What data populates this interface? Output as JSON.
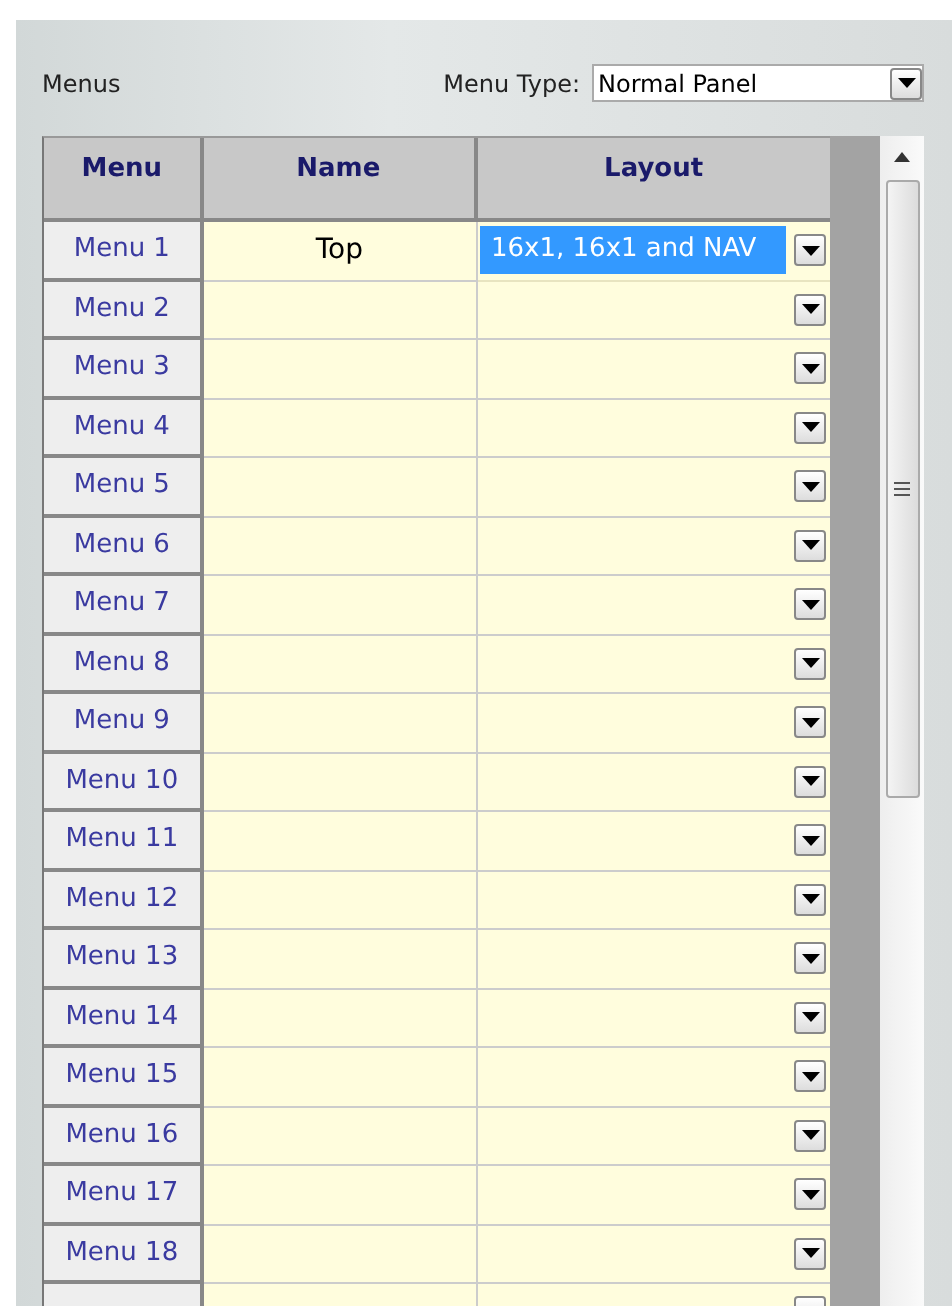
{
  "panel": {
    "title": "Menus",
    "menu_type_label": "Menu Type:",
    "menu_type_value": "Normal Panel"
  },
  "table": {
    "columns": [
      "Menu",
      "Name",
      "Layout"
    ],
    "rows": [
      {
        "menu": "Menu 1",
        "name": "Top",
        "layout": "16x1, 16x1 and NAV",
        "selected": true
      },
      {
        "menu": "Menu 2",
        "selected": false
      },
      {
        "menu": "Menu 3",
        "selected": false
      },
      {
        "menu": "Menu 4",
        "selected": false
      },
      {
        "menu": "Menu 5",
        "selected": false
      },
      {
        "menu": "Menu 6",
        "selected": false
      },
      {
        "menu": "Menu 7",
        "selected": false
      },
      {
        "menu": "Menu 8",
        "selected": false
      },
      {
        "menu": "Menu 9",
        "selected": false
      },
      {
        "menu": "Menu 10",
        "selected": false
      },
      {
        "menu": "Menu 11",
        "selected": false
      },
      {
        "menu": "Menu 12",
        "selected": false
      },
      {
        "menu": "Menu 13",
        "selected": false
      },
      {
        "menu": "Menu 14",
        "selected": false
      },
      {
        "menu": "Menu 15",
        "selected": false
      },
      {
        "menu": "Menu 16",
        "selected": false
      },
      {
        "menu": "Menu 17",
        "selected": false
      },
      {
        "menu": "Menu 18",
        "selected": false
      },
      {
        "selected": false
      }
    ]
  }
}
